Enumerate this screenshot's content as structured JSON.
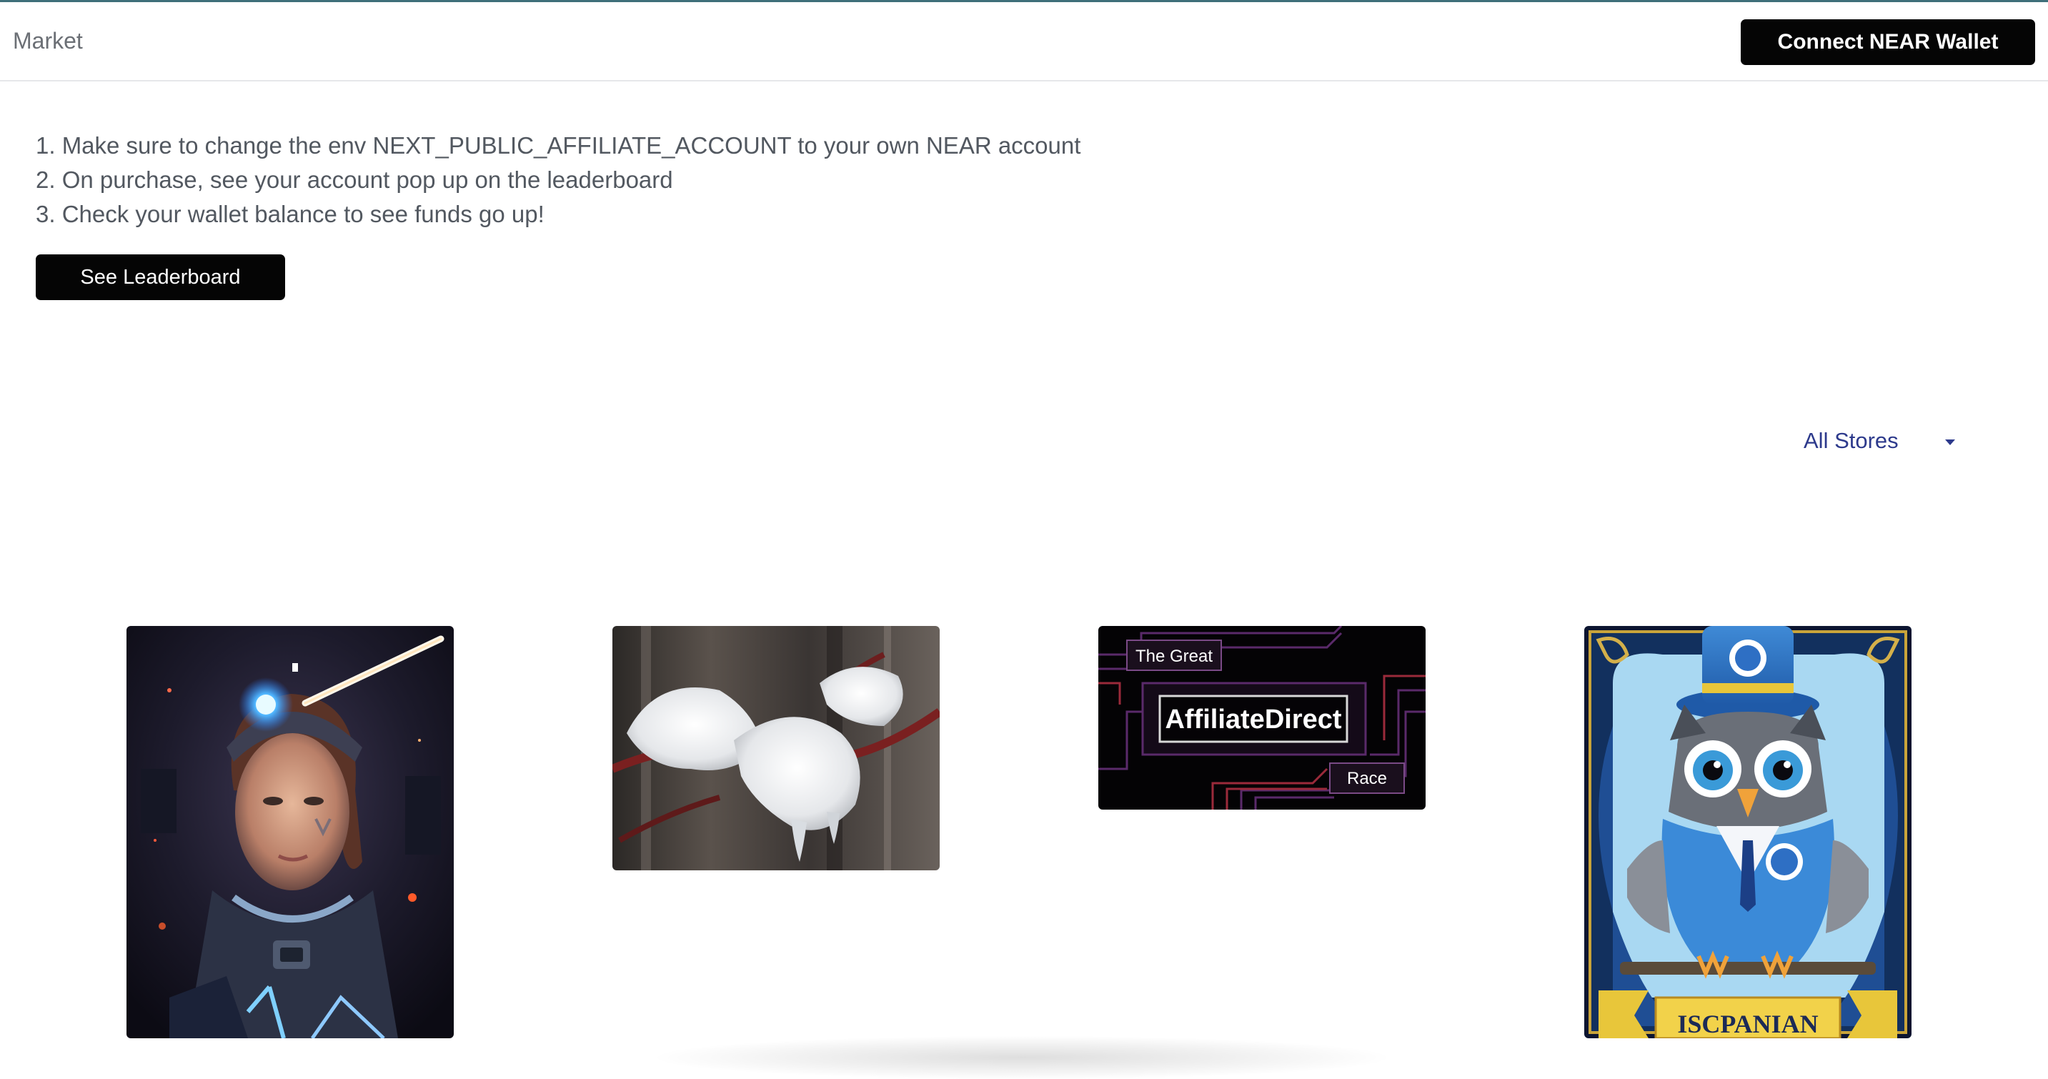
{
  "navbar": {
    "title": "Market",
    "connect_label": "Connect NEAR Wallet"
  },
  "instructions": [
    "1. Make sure to change the env NEXT_PUBLIC_AFFILIATE_ACCOUNT to your own NEAR account",
    "2. On purchase, see your account pop up on the leaderboard",
    "3. Check your wallet balance to see funds go up!"
  ],
  "leaderboard_button": "See Leaderboard",
  "store_filter": {
    "selected": "All Stores",
    "icon": "chevron-down-icon"
  },
  "cards": [
    {
      "name": "cyborg-woman-artwork"
    },
    {
      "name": "snowy-branch-photo"
    },
    {
      "name": "affiliate-direct-race-banner",
      "top_label": "The Great",
      "title": "AffiliateDirect",
      "bottom_label": "Race"
    },
    {
      "name": "owl-mascot-card",
      "banner": "ISCPANIAN"
    }
  ],
  "colors": {
    "accent_line": "#3f6f7a",
    "button_bg": "#050505",
    "dropdown_text": "#2d3a8c",
    "body_text": "#525860"
  }
}
